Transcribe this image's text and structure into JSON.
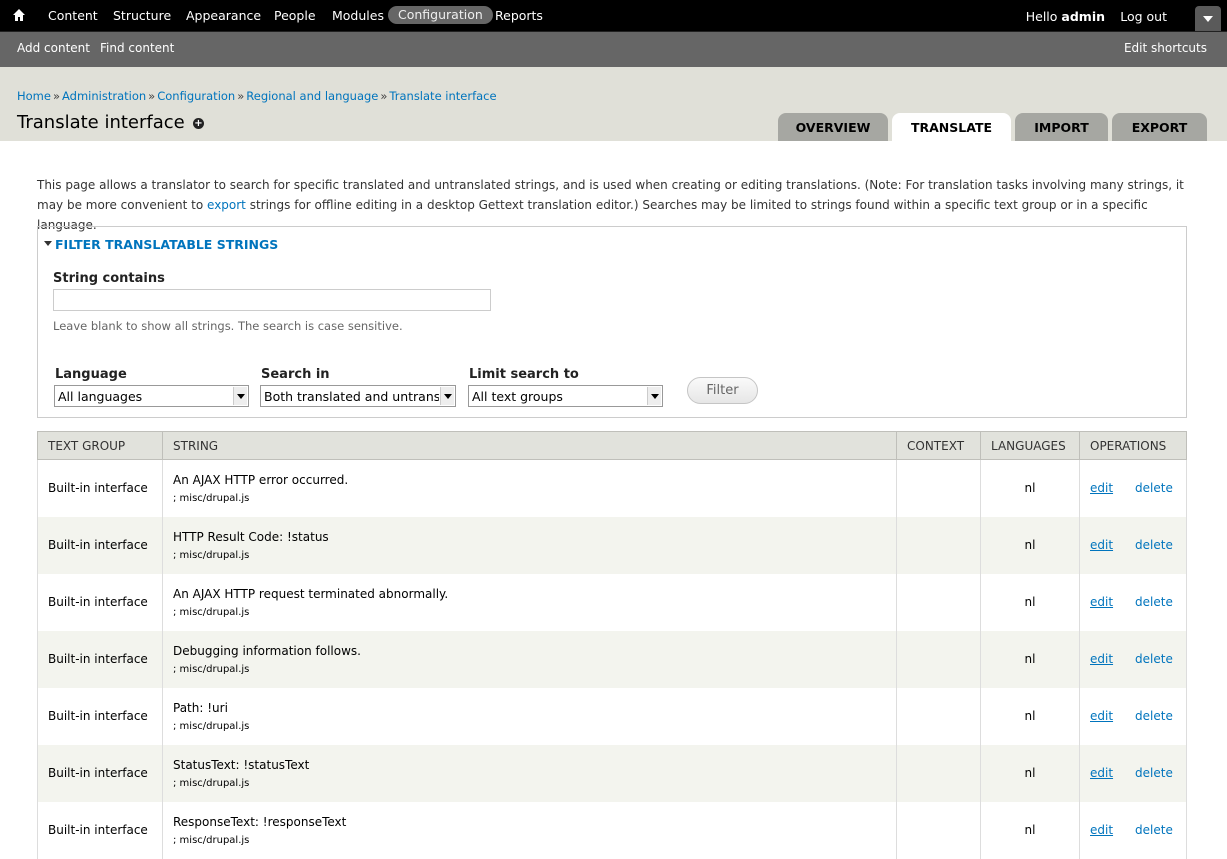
{
  "toolbar": {
    "menu": [
      "Content",
      "Structure",
      "Appearance",
      "People",
      "Modules",
      "Configuration",
      "Reports"
    ],
    "active": "Configuration",
    "hello_prefix": "Hello ",
    "user": "admin",
    "logout": "Log out"
  },
  "shortcuts": {
    "items": [
      "Add content",
      "Find content"
    ],
    "edit": "Edit shortcuts"
  },
  "breadcrumb": [
    "Home",
    "Administration",
    "Configuration",
    "Regional and language",
    "Translate interface"
  ],
  "breadcrumb_sep": "»",
  "page_title": "Translate interface",
  "tabs": [
    "Overview",
    "Translate",
    "Import",
    "Export"
  ],
  "active_tab": "Translate",
  "intro": {
    "before": "This page allows a translator to search for specific translated and untranslated strings, and is used when creating or editing translations. (Note: For translation tasks involving many strings, it may be more convenient to ",
    "link": "export",
    "after": " strings for offline editing in a desktop Gettext translation editor.) Searches may be limited to strings found within a specific text group or in a specific language."
  },
  "filter": {
    "legend": "Filter translatable strings",
    "string_contains_label": "String contains",
    "string_contains_value": "",
    "description": "Leave blank to show all strings. The search is case sensitive.",
    "language_label": "Language",
    "language_value": "All languages",
    "search_in_label": "Search in",
    "search_in_value": "Both translated and untranslated strings",
    "limit_label": "Limit search to",
    "limit_value": "All text groups",
    "button": "Filter"
  },
  "table": {
    "headers": [
      "Text group",
      "String",
      "Context",
      "Languages",
      "Operations"
    ],
    "rows": [
      {
        "group": "Built-in interface",
        "string": "An AJAX HTTP error occurred.",
        "location": "; misc/drupal.js",
        "context": "",
        "languages": "nl"
      },
      {
        "group": "Built-in interface",
        "string": "HTTP Result Code: !status",
        "location": "; misc/drupal.js",
        "context": "",
        "languages": "nl"
      },
      {
        "group": "Built-in interface",
        "string": "An AJAX HTTP request terminated abnormally.",
        "location": "; misc/drupal.js",
        "context": "",
        "languages": "nl"
      },
      {
        "group": "Built-in interface",
        "string": "Debugging information follows.",
        "location": "; misc/drupal.js",
        "context": "",
        "languages": "nl"
      },
      {
        "group": "Built-in interface",
        "string": "Path: !uri",
        "location": "; misc/drupal.js",
        "context": "",
        "languages": "nl"
      },
      {
        "group": "Built-in interface",
        "string": "StatusText: !statusText",
        "location": "; misc/drupal.js",
        "context": "",
        "languages": "nl"
      },
      {
        "group": "Built-in interface",
        "string": "ResponseText: !responseText",
        "location": "; misc/drupal.js",
        "context": "",
        "languages": "nl"
      }
    ],
    "edit_label": "edit",
    "delete_label": "delete"
  },
  "colors": {
    "link": "#0074bd",
    "toolbar_bg": "#000000",
    "shortcut_bg": "#666666",
    "header_bg": "#e0e0d8"
  }
}
